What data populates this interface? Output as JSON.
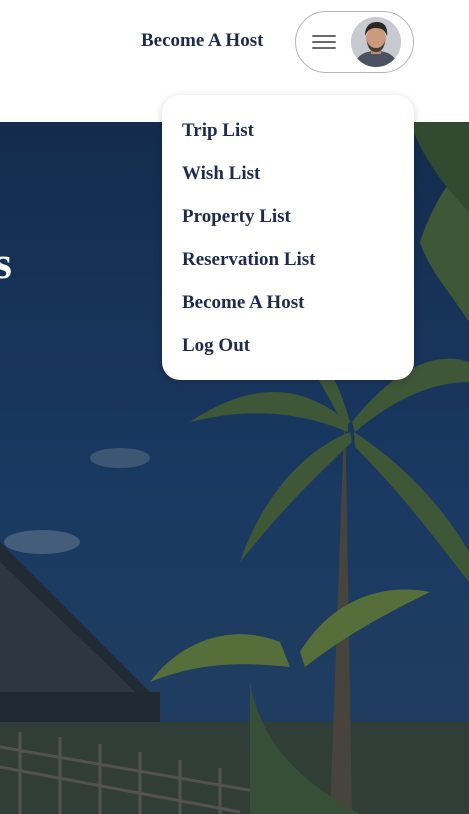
{
  "header": {
    "host_link": "Become A Host",
    "menu_icon": "hamburger-icon",
    "avatar": "user-avatar"
  },
  "hero": {
    "title_fragment": "s"
  },
  "dropdown": {
    "items": [
      {
        "label": "Trip List"
      },
      {
        "label": "Wish List"
      },
      {
        "label": "Property List"
      },
      {
        "label": "Reservation List"
      },
      {
        "label": "Become A Host"
      },
      {
        "label": "Log Out"
      }
    ]
  },
  "colors": {
    "text_navy": "#1f2b4d",
    "sky": "#1c3a66"
  }
}
